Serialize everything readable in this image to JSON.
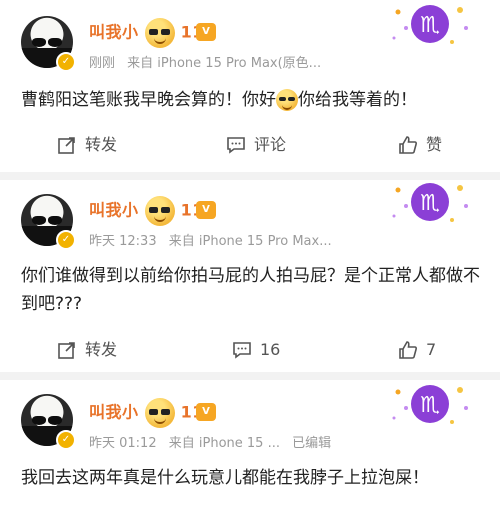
{
  "posts": [
    {
      "name_prefix": "叫我小",
      "name_suffix": "112",
      "level": "V",
      "time": "刚刚",
      "source": "来自 iPhone 15 Pro Max(原色...",
      "edited": "",
      "content_before": "曹鹤阳这笔账我早晚会算的！你好",
      "content_after": "你给我等着的！",
      "repost_label": "转发",
      "comment_label": "评论",
      "like_label": "赞"
    },
    {
      "name_prefix": "叫我小",
      "name_suffix": "112",
      "level": "V",
      "time": "昨天 12:33",
      "source": "来自 iPhone 15 Pro Max...",
      "edited": "",
      "content": "你们谁做得到以前给你拍马屁的人拍马屁？是个正常人都做不到吧???",
      "repost_label": "转发",
      "comment_label": "16",
      "like_label": "7"
    },
    {
      "name_prefix": "叫我小",
      "name_suffix": "112",
      "level": "V",
      "time": "昨天 01:12",
      "source": "来自 iPhone 15 ...",
      "edited": "已编辑",
      "content": "我回去这两年真是什么玩意儿都能在我脖子上拉泡屎！"
    }
  ],
  "colors": {
    "name": "#e8732a",
    "meta": "#9a9a9a",
    "badge": "#f2b200",
    "deco_purple": "#8b3fd6",
    "divider": "#f2f2f2"
  },
  "icons": {
    "repost": "repost-icon",
    "comment": "comment-icon",
    "like": "like-icon",
    "verified": "verified-badge-icon",
    "zodiac": "scorpio-icon"
  }
}
